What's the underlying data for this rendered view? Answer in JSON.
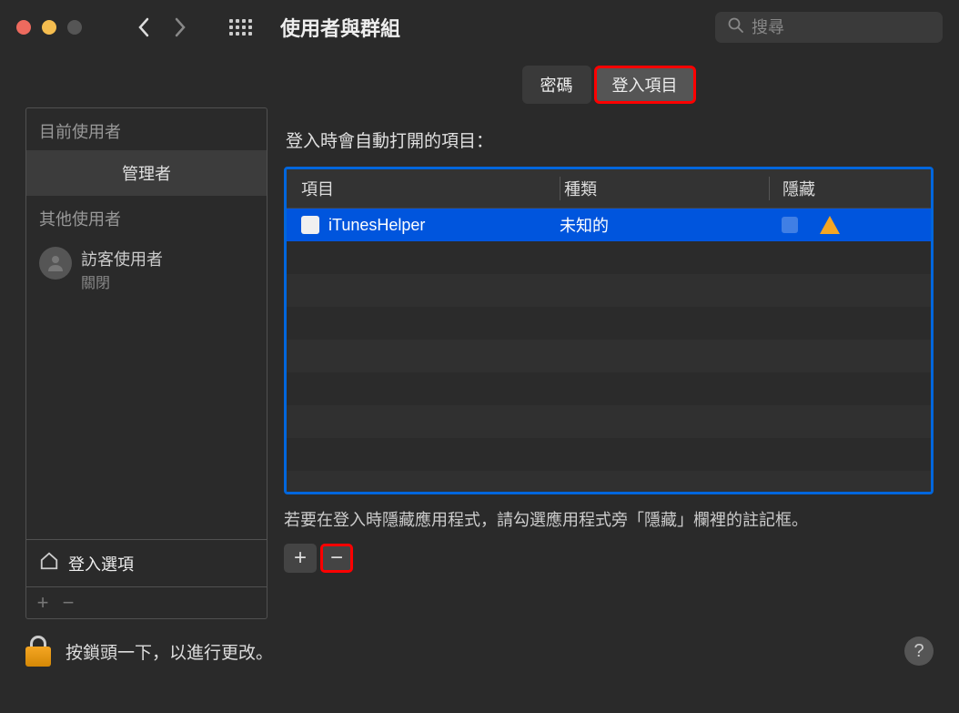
{
  "window_title": "使用者與群組",
  "search": {
    "placeholder": "搜尋"
  },
  "sidebar": {
    "current_user_header": "目前使用者",
    "admin_label": "管理者",
    "other_users_header": "其他使用者",
    "guest": {
      "name": "訪客使用者",
      "status": "關閉"
    },
    "login_options": "登入選項"
  },
  "tabs": {
    "password": "密碼",
    "login_items": "登入項目"
  },
  "main": {
    "section_title": "登入時會自動打開的項目：",
    "columns": {
      "item": "項目",
      "kind": "種類",
      "hide": "隱藏"
    },
    "rows": [
      {
        "name": "iTunesHelper",
        "kind": "未知的"
      }
    ],
    "hint": "若要在登入時隱藏應用程式，請勾選應用程式旁「隱藏」欄裡的註記框。"
  },
  "footer": {
    "lock_text": "按鎖頭一下，以進行更改。"
  }
}
